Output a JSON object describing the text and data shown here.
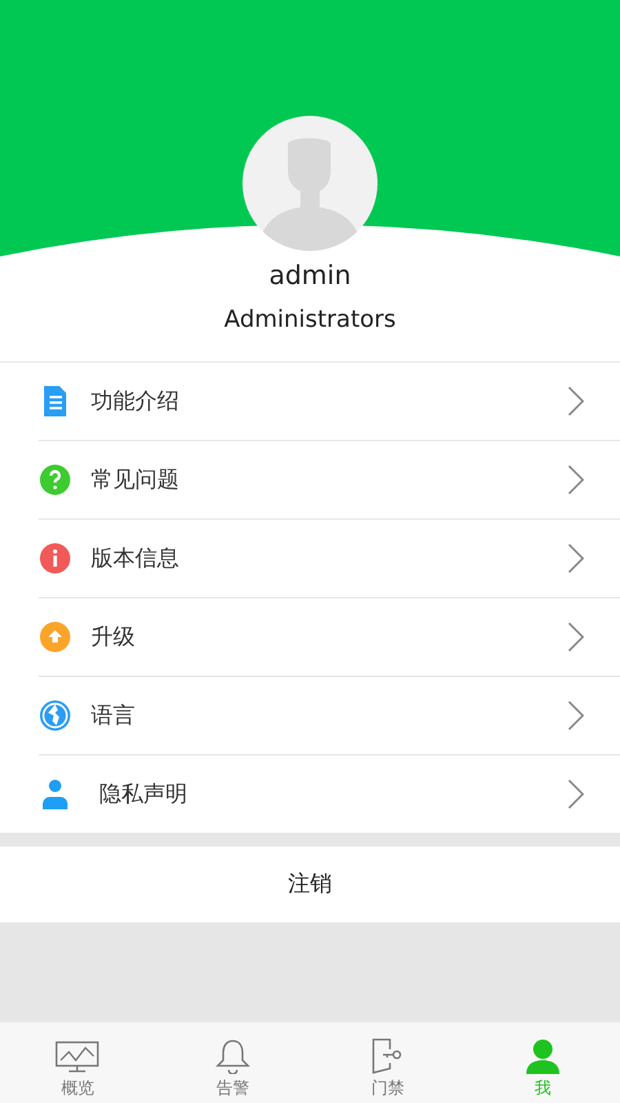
{
  "profile": {
    "name": "admin",
    "role": "Administrators"
  },
  "menu": [
    {
      "kind": "doc",
      "label": "功能介绍"
    },
    {
      "kind": "question",
      "label": "常见问题"
    },
    {
      "kind": "info",
      "label": "版本信息"
    },
    {
      "kind": "upgrade",
      "label": "升级"
    },
    {
      "kind": "globe",
      "label": "语言"
    },
    {
      "kind": "person",
      "label": "隐私声明"
    }
  ],
  "logout": "注销",
  "tabs": [
    {
      "kind": "monitor",
      "label": "概览",
      "selected": false
    },
    {
      "kind": "bell",
      "label": "告警",
      "selected": false
    },
    {
      "kind": "door",
      "label": "门禁",
      "selected": false
    },
    {
      "kind": "user",
      "label": "我",
      "selected": true
    }
  ]
}
